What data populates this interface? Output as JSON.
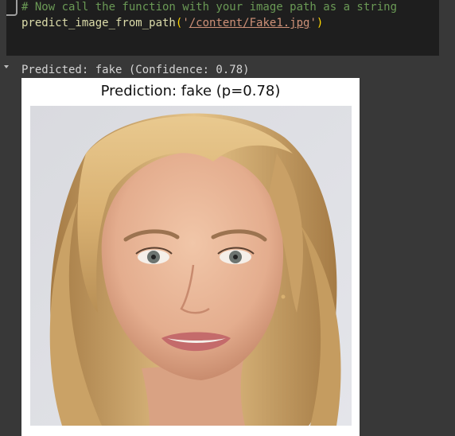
{
  "code_cell": {
    "comment": "# Now call the function with your image path as a string",
    "call": {
      "function": "predict_image_from_path",
      "open": "(",
      "quote_open": "'",
      "path": "/content/Fake1.jpg",
      "quote_close": "'",
      "close": ")"
    }
  },
  "output": {
    "stdout": "Predicted: fake (Confidence: 0.78)",
    "figure_title": "Prediction: fake (p=0.78)",
    "image_alt": "face photo"
  },
  "colors": {
    "code_bg": "#1e1e1e",
    "output_bg": "#383838",
    "comment": "#6a9955",
    "string": "#ce9178"
  }
}
